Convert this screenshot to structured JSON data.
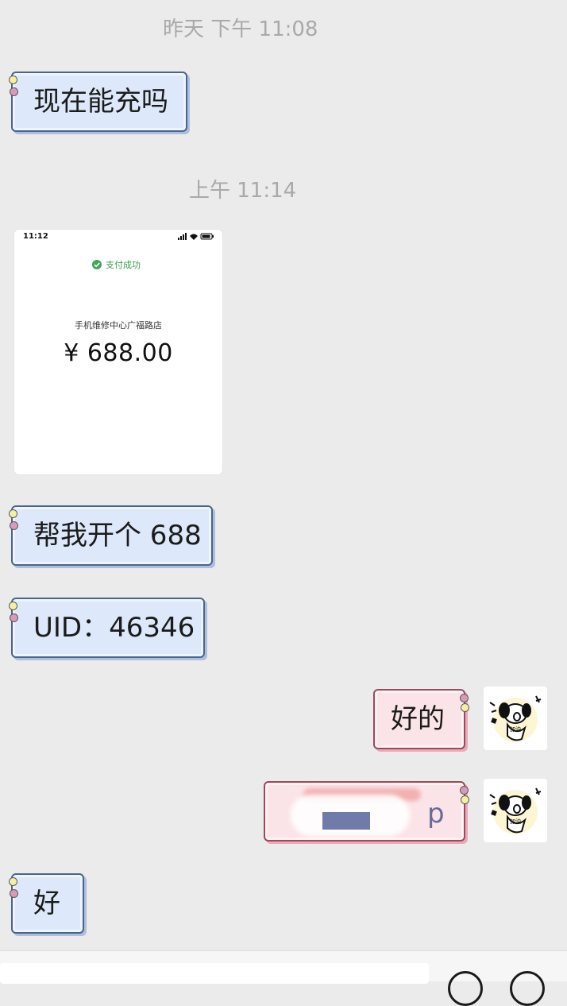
{
  "timestamps": {
    "first": "昨天 下午 11:08",
    "second": "上午 11:14"
  },
  "messages": {
    "m1": "现在能充吗",
    "m3": "帮我开个 688",
    "m4": "UID：46346",
    "m5": "好的",
    "m6": "p",
    "m7": "好"
  },
  "payment_screenshot": {
    "status_bar_time": "11:12",
    "status": "支付成功",
    "merchant": "手机维修中心广福路店",
    "amount": "¥ 688.00"
  },
  "colors": {
    "left_bubble_fill": "#dde9fa",
    "left_bubble_border": "#4a6588",
    "right_bubble_fill": "#fbe4e8",
    "right_bubble_border": "#9a4a5c",
    "background": "#ebebeb",
    "timestamp_text": "#a9a9a9",
    "payment_success_green": "#3fa65a"
  },
  "icons": {
    "avatar": "cartoon-dog-sticker-avatar",
    "input_right_buttons": [
      "emoji-icon",
      "add-icon"
    ]
  }
}
